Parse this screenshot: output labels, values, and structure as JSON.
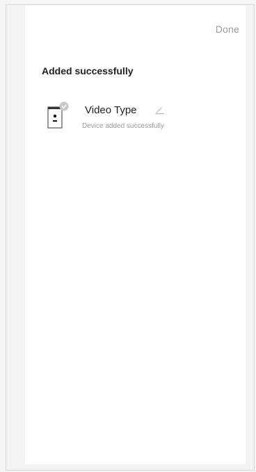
{
  "header": {
    "done_label": "Done"
  },
  "main": {
    "title": "Added successfully",
    "devices": [
      {
        "name": "Video Type",
        "status": "Device added successfully",
        "icon": "doorbell-device-icon",
        "badge_icon": "check-badge-icon",
        "edit_icon": "pencil-edit-icon"
      }
    ]
  },
  "colors": {
    "background": "#f3f3f3",
    "panel": "#ffffff",
    "text_primary": "#1f1f1f",
    "text_secondary": "#9a9a9a",
    "badge": "#c7c7c7"
  }
}
